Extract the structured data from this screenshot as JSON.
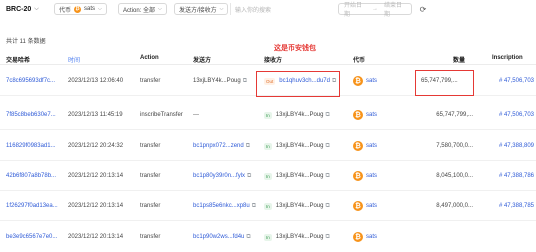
{
  "filters": {
    "protocol": "BRC-20",
    "coin_prefix": "代币",
    "coin_value": "sats",
    "action_label": "Action: 全部",
    "party_label": "发送方/接收方",
    "search_placeholder": "输入你的搜索",
    "start_date": "开始日期",
    "arrow": "→",
    "end_date": "结束日期"
  },
  "summary": {
    "count_text": "共计 11 条数据"
  },
  "annotation": {
    "text": "这是币安钱包"
  },
  "table": {
    "headers": {
      "hash": "交易哈希",
      "time": "时间",
      "action": "Action",
      "from": "发送方",
      "to": "接收方",
      "coin": "代币",
      "amount": "数量",
      "inscription": "Inscription"
    },
    "rows": [
      {
        "hash": "7c8c695693df7c...",
        "time": "2023/12/13 12:06:40",
        "action": "transfer",
        "from": "13xjLBY4k...Poug",
        "to_tag": "Out",
        "to": "bc1qhuv3ch...du7d",
        "coin": "sats",
        "amount": "65,747,799,...",
        "inscription": "# 47,506,703"
      },
      {
        "hash": "7f85c8beb630e7...",
        "time": "2023/12/13 11:45:19",
        "action": "inscribeTransfer",
        "from": "---",
        "to_tag": "In",
        "to": "13xjLBY4k...Poug",
        "coin": "sats",
        "amount": "65,747,799,...",
        "inscription": "# 47,506,703"
      },
      {
        "hash": "116829f0983ad1...",
        "time": "2023/12/12 20:24:32",
        "action": "transfer",
        "from": "bc1pnpx072...zend",
        "to_tag": "In",
        "to": "13xjLBY4k...Poug",
        "coin": "sats",
        "amount": "7,580,700,0...",
        "inscription": "# 47,388,809"
      },
      {
        "hash": "42b6f807a8b78b...",
        "time": "2023/12/12 20:13:14",
        "action": "transfer",
        "from": "bc1p80y39r0n...fylx",
        "to_tag": "In",
        "to": "13xjLBY4k...Poug",
        "coin": "sats",
        "amount": "8,045,100,0...",
        "inscription": "# 47,388,786"
      },
      {
        "hash": "1f26297f0ad13ea...",
        "time": "2023/12/12 20:13:14",
        "action": "transfer",
        "from": "bc1ps85e6nkc...xp8u",
        "to_tag": "In",
        "to": "13xjLBY4k...Poug",
        "coin": "sats",
        "amount": "8,497,000,0...",
        "inscription": "# 47,388,785"
      },
      {
        "hash": "be3e9c6567e7e0...",
        "time": "2023/12/12 20:13:14",
        "action": "transfer",
        "from": "bc1p90w2ws...fd4u",
        "to_tag": "In",
        "to": "13xjLBY4k...Poug",
        "coin": "sats",
        "amount": "",
        "inscription": ""
      }
    ]
  },
  "colors": {
    "accent": "#2f5bd7",
    "annotation_red": "#e53935",
    "btc_orange": "#f7931a"
  }
}
